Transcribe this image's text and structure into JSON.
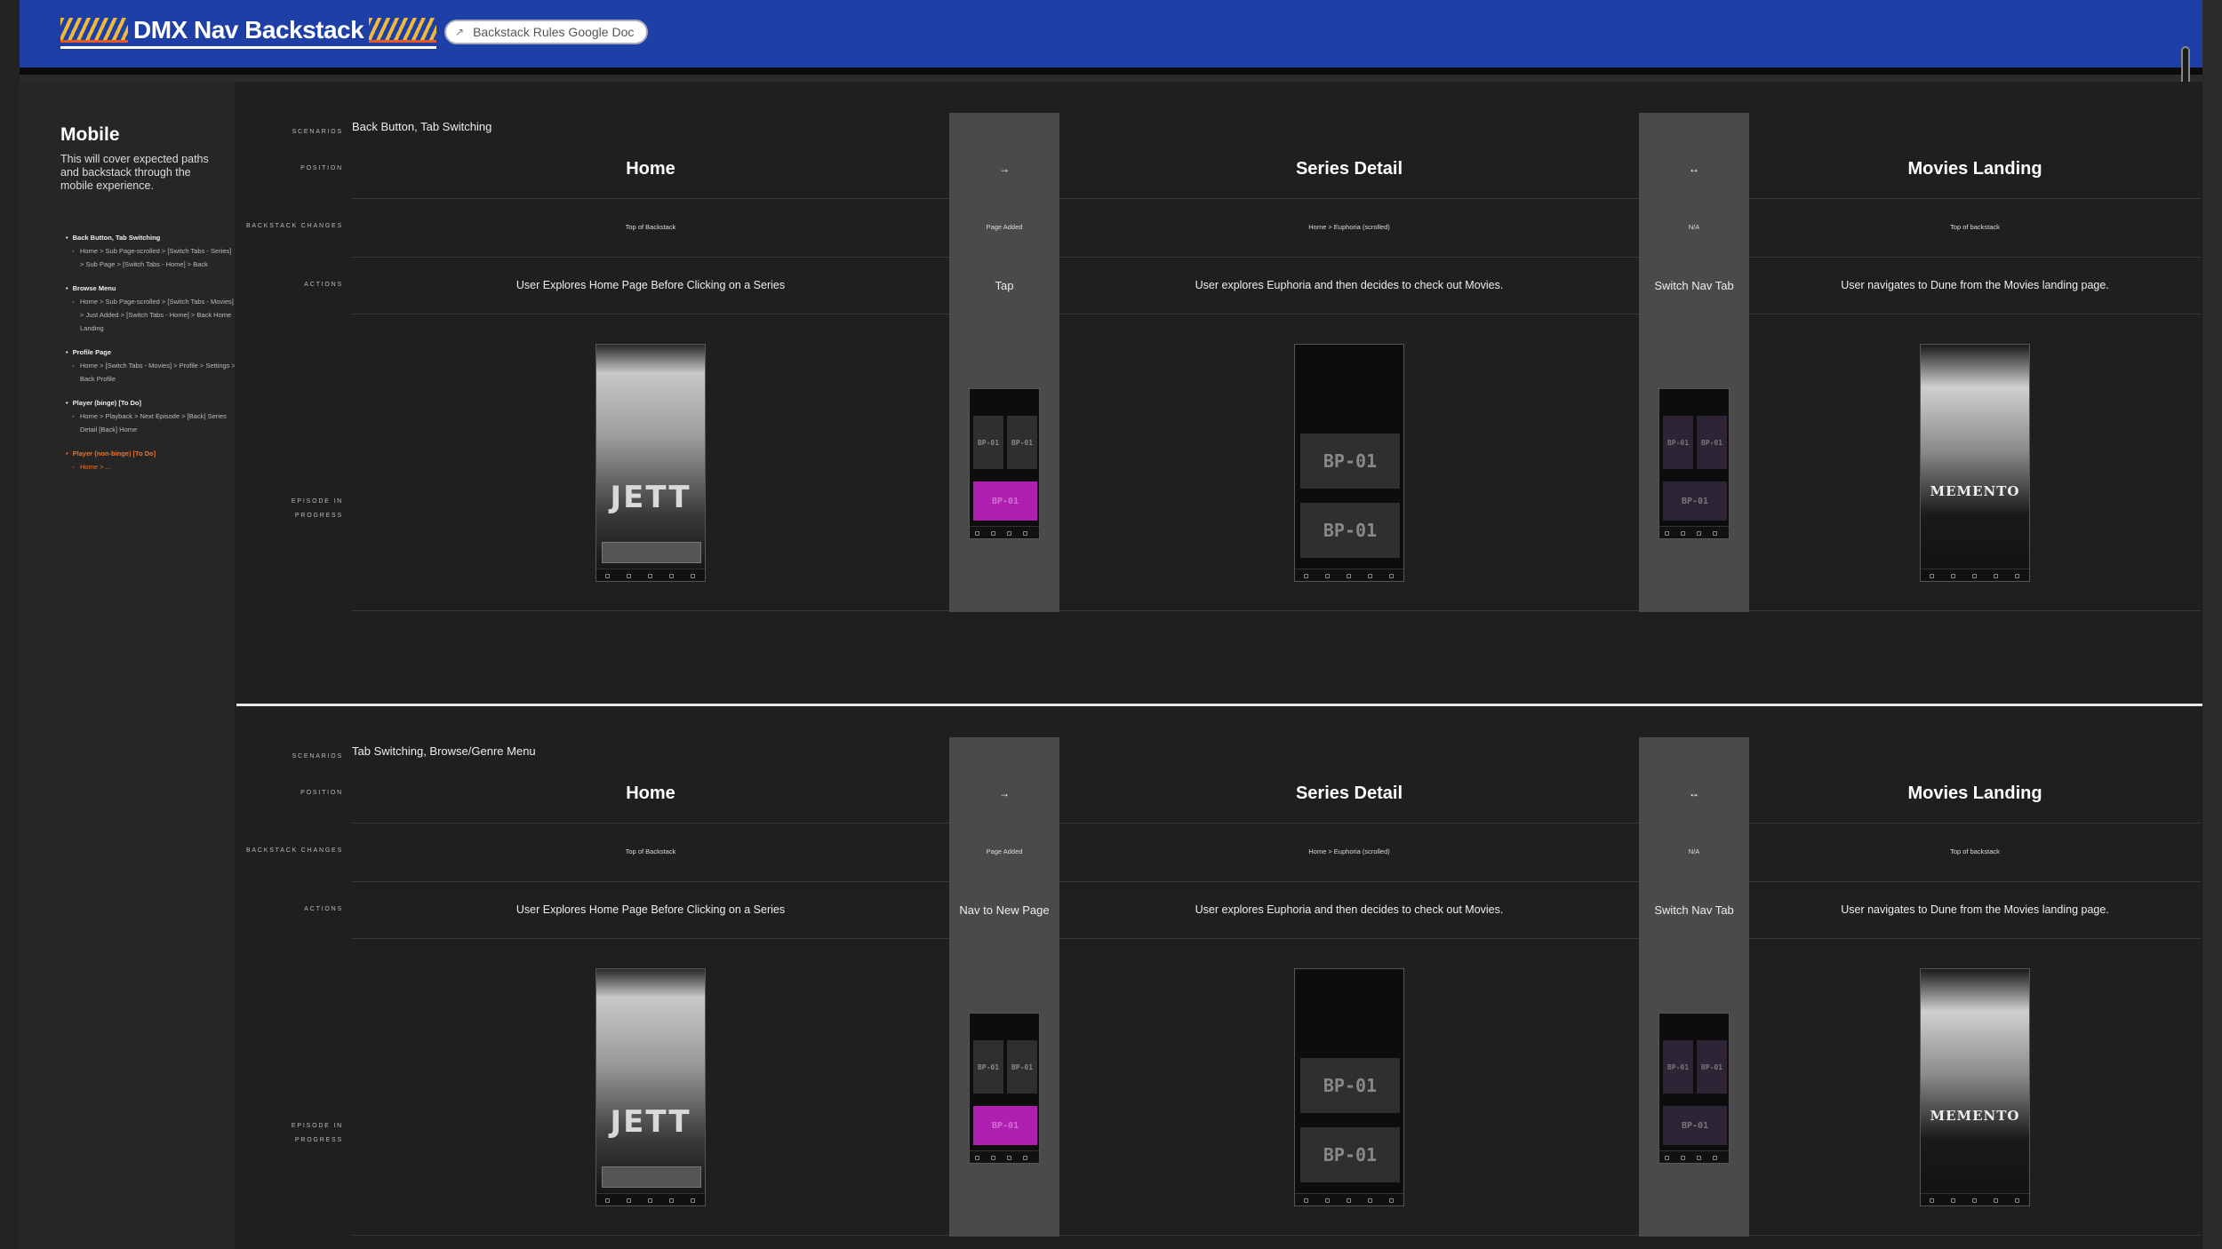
{
  "header": {
    "title": "DMX Nav Backstack",
    "doc_link_label": "Backstack Rules Google Doc",
    "doc_link_icon": "external-link-icon",
    "background_color": "#1e3fa5"
  },
  "sidebar": {
    "title": "Mobile",
    "description": "This will cover expected paths and backstack through the mobile experience.",
    "items": [
      {
        "label": "Back Button, Tab Switching",
        "sub": "Home > Sub Page-scrolled > [Switch Tabs - Series] > Sub Page > [Switch Tabs - Home] > Back"
      },
      {
        "label": "Browse Menu",
        "sub": "Home > Sub Page-scrolled > [Switch Tabs - Movies] > Just Added > [Switch Tabs - Home] > Back Home Landing"
      },
      {
        "label": "Profile Page",
        "sub": "Home > [Switch Tabs - Movies] > Profile > Settings > Back Profile"
      },
      {
        "label": "Player (binge) [To Do]",
        "sub": "Home > Playback > Next Episode > [Back] Series Detail [Back] Home"
      },
      {
        "label": "Player (non-binge) [To Do]",
        "sub": "Home > ..."
      }
    ],
    "highlight_color": "#e8752c"
  },
  "row_labels": {
    "scenarios": "SCENARIOS",
    "position": "POSITION",
    "backstack_changes": "BACKSTACK CHANGES",
    "actions": "ACTIONS",
    "episode_line1": "EPISODE IN",
    "episode_line2": "PROGRESS"
  },
  "sections": [
    {
      "scenario": "Back Button, Tab Switching",
      "columns": [
        {
          "title": "Home",
          "backstack": "Top of Backstack",
          "action": "User Explores Home Page Before Clicking on a Series"
        },
        {
          "title": "→",
          "backstack": "Page Added",
          "action": "Tap"
        },
        {
          "title": "Series Detail",
          "backstack": "Home > Euphoria (scrolled)",
          "action": "User explores Euphoria and then decides to check out Movies."
        },
        {
          "title": "↔",
          "backstack": "N/A",
          "action": "Switch Nav Tab"
        },
        {
          "title": "Movies Landing",
          "backstack": "Top of backstack",
          "action": "User navigates to Dune from the Movies landing page."
        }
      ]
    },
    {
      "scenario": "Tab Switching, Browse/Genre Menu",
      "columns": [
        {
          "title": "Home",
          "backstack": "Top of Backstack",
          "action": "User Explores Home Page Before Clicking on a Series"
        },
        {
          "title": "→",
          "backstack": "Page Added",
          "action": "Nav to New Page"
        },
        {
          "title": "Series Detail",
          "backstack": "Home > Euphoria (scrolled)",
          "action": "User explores Euphoria and then decides to check out Movies."
        },
        {
          "title": "↔",
          "backstack": "N/A",
          "action": "Switch Nav Tab"
        },
        {
          "title": "Movies Landing",
          "backstack": "Top of backstack",
          "action": "User navigates to Dune from the Movies landing page."
        }
      ]
    }
  ],
  "mockups": {
    "home_logo": "JETT",
    "tile_label": "BP-01",
    "movies_logo": "MEMENTO"
  }
}
